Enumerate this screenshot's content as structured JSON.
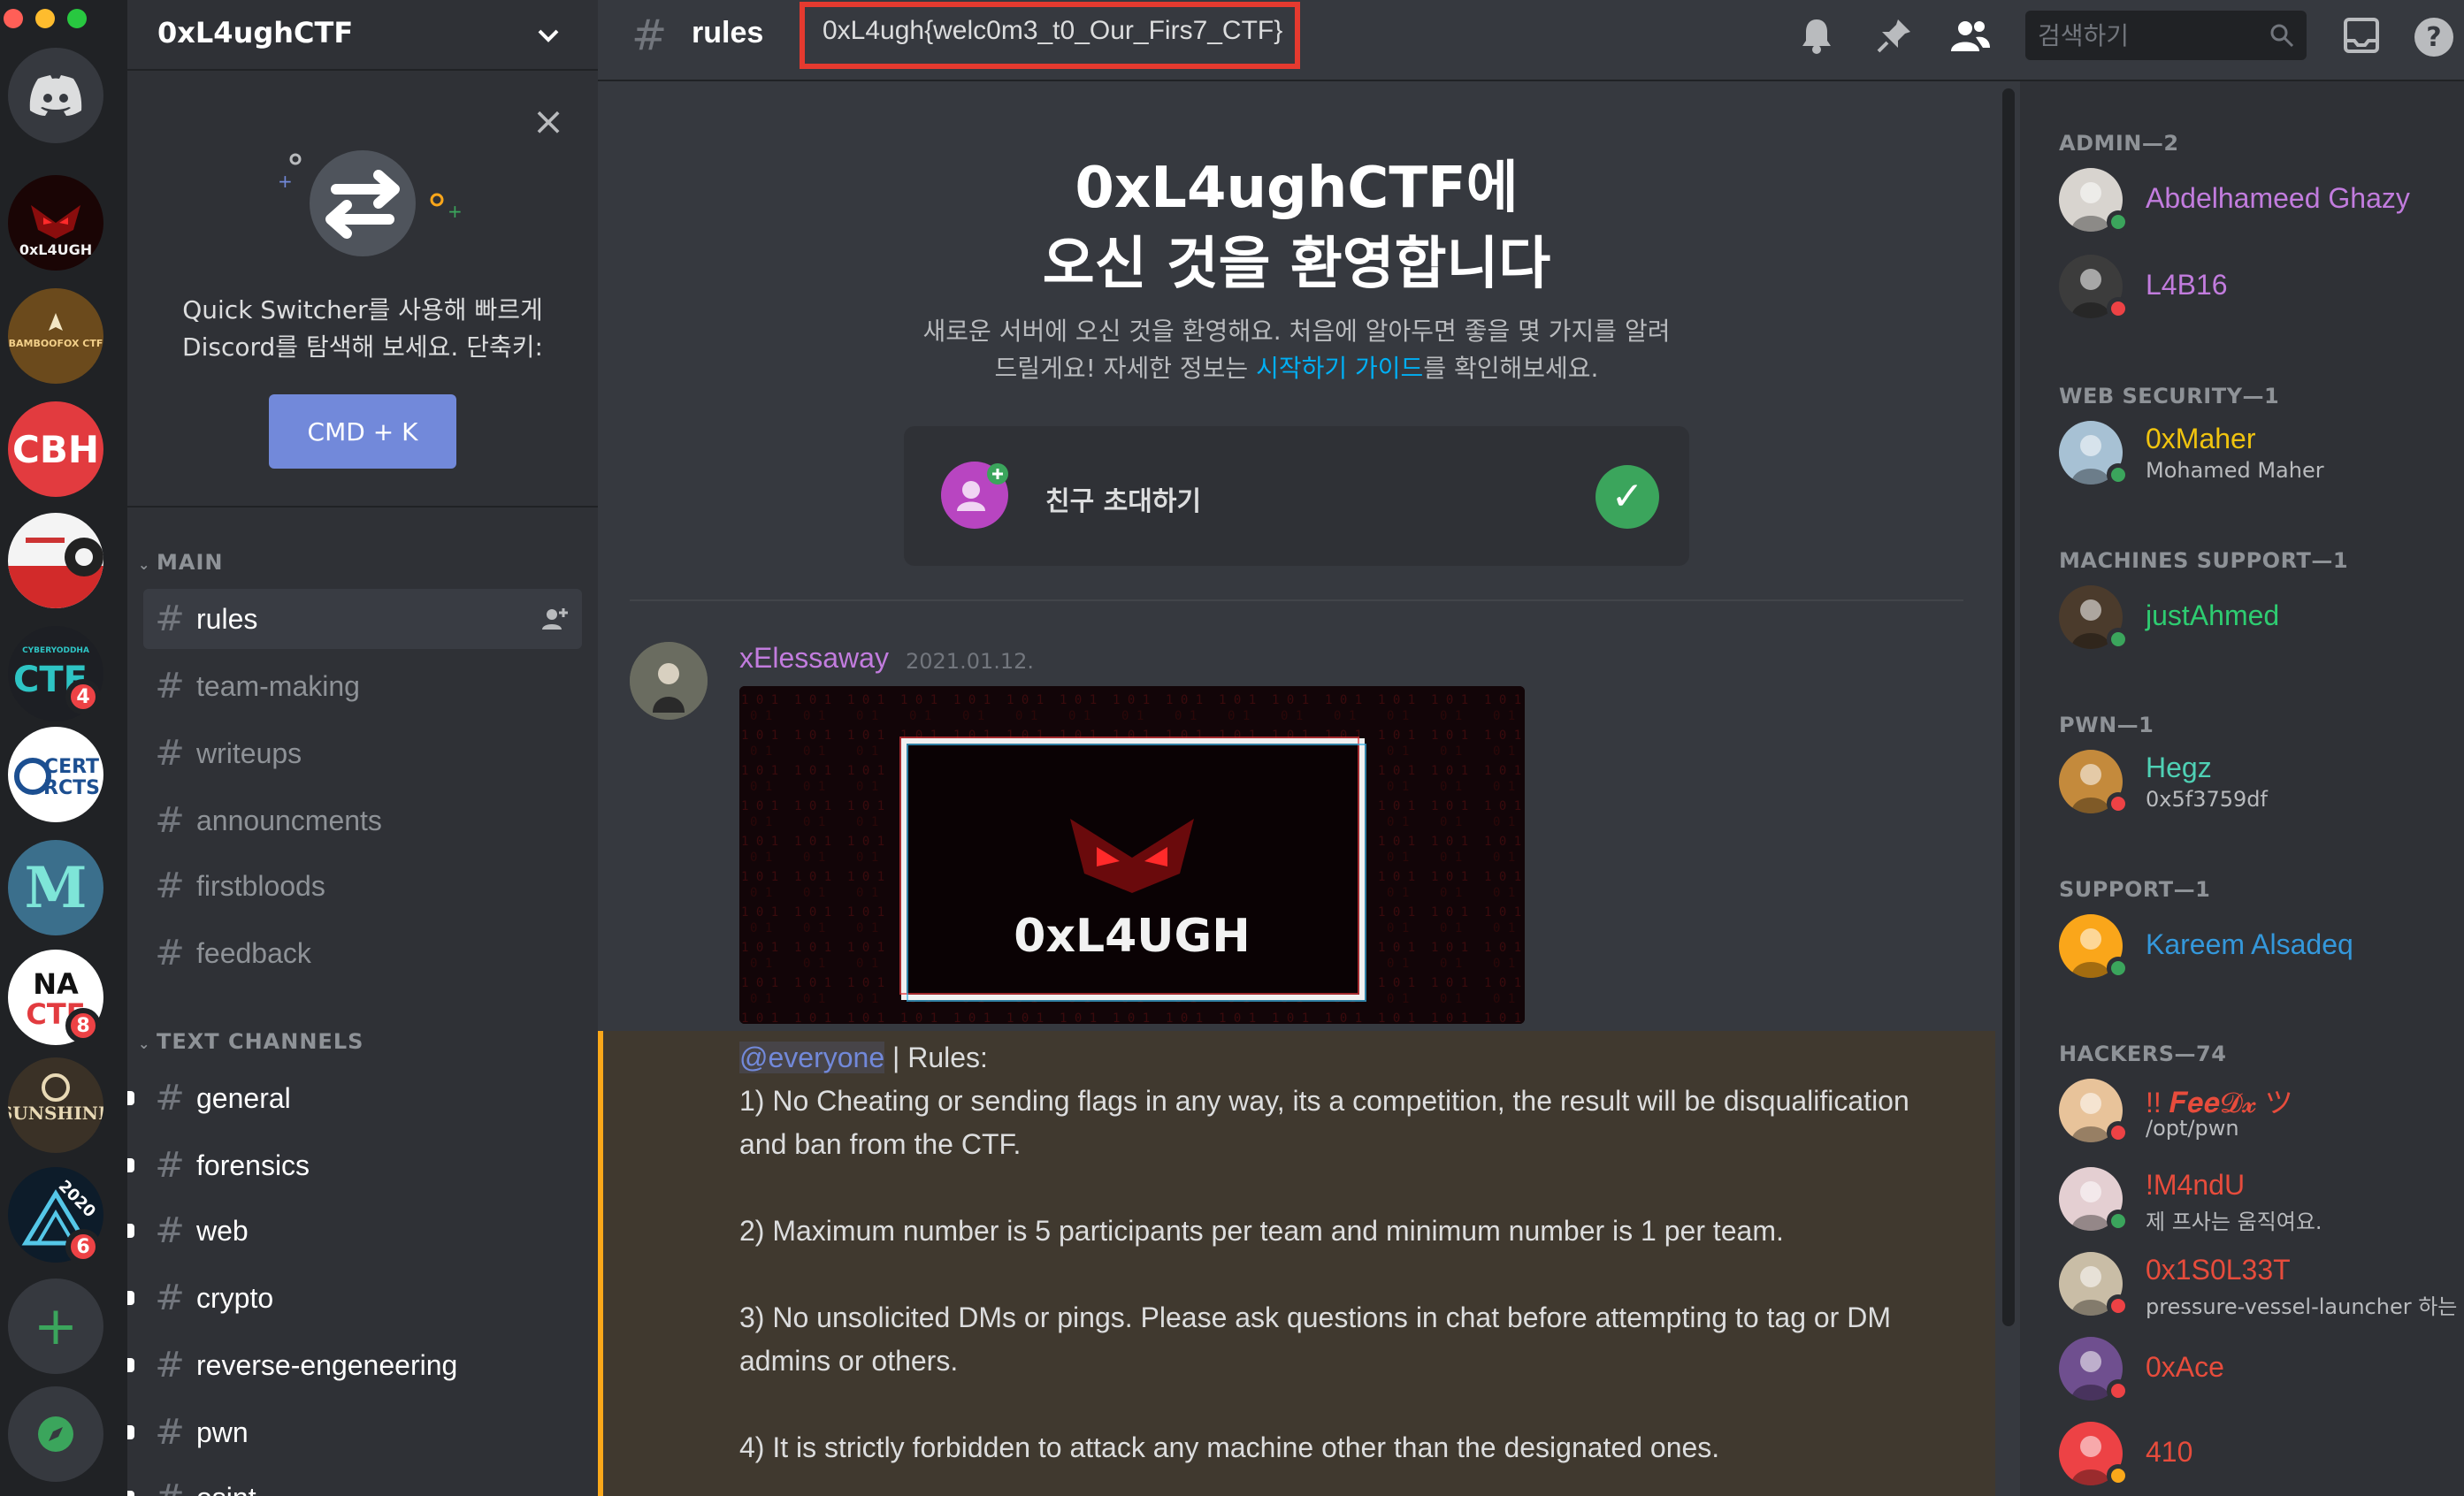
{
  "window": {
    "traffic_colors": [
      "#ff5f57",
      "#febc2e",
      "#28c840"
    ]
  },
  "servers": [
    {
      "name": "home",
      "label": ""
    },
    {
      "name": "0xl4ugh",
      "label": "0xL4UGH",
      "bg": "#1a0505",
      "fg": "#e03030"
    },
    {
      "name": "bamboofox",
      "label": "BAMBOOFOX CTF",
      "bg": "#6b4a1c",
      "fg": "#f3d08a"
    },
    {
      "name": "cbh",
      "label": "CBH",
      "bg": "#e23b3f",
      "fg": "#ffffff"
    },
    {
      "name": "meituan",
      "label": "",
      "bg": "#f4f4f4",
      "fg": "#d22"
    },
    {
      "name": "cyberyoddha",
      "label": "CTF",
      "bg": "#1d1f24",
      "fg": "#2ec4c4",
      "badge": "4"
    },
    {
      "name": "cert",
      "label": "CERT RCTS",
      "bg": "#ffffff",
      "fg": "#1c4f91"
    },
    {
      "name": "m",
      "label": "M",
      "bg": "#3b6f8c",
      "fg": "#7ee5d8"
    },
    {
      "name": "nactf",
      "label": "NA CTF",
      "bg": "#ffffff",
      "fg": "#111111",
      "badge": "8"
    },
    {
      "name": "sunshine",
      "label": "SUNSHINE",
      "bg": "#3a3126",
      "fg": "#e8d9b5"
    },
    {
      "name": "ctf-2020",
      "label": "2020",
      "bg": "#0d1c2a",
      "fg": "#55c7e8",
      "badge": "6"
    }
  ],
  "sidebar": {
    "server_name": "0xL4ughCTF",
    "quick_switcher_text": "Quick Switcher를 사용해 빠르게\nDiscord를 탐색해 보세요. 단축키:",
    "quick_switcher_button": "CMD + K",
    "categories": {
      "main": "MAIN",
      "text": "TEXT CHANNELS"
    },
    "main_channels": [
      "rules",
      "team-making",
      "writeups",
      "announcments",
      "firstbloods",
      "feedback"
    ],
    "text_channels": [
      "general",
      "forensics",
      "web",
      "crypto",
      "reverse-engeneering",
      "pwn",
      "osint"
    ]
  },
  "header": {
    "channel": "rules",
    "topic": "0xL4ugh{welc0m3_t0_Our_Firs7_CTF}",
    "search_placeholder": "검색하기"
  },
  "welcome": {
    "title_line1": "0xL4ughCTF에",
    "title_line2": "오신 것을 환영합니다",
    "sub_line1": "새로운 서버에 오신 것을 환영해요. 처음에 알아두면 좋을 몇 가지를 알려",
    "sub_line2_before": "드릴게요! 자세한 정보는 ",
    "sub_line2_link": "시작하기 가이드",
    "sub_line2_after": "를 확인해보세요.",
    "invite_label": "친구 초대하기"
  },
  "message": {
    "author": "xElessaway",
    "timestamp": "2021.01.12.",
    "image_text": "0xL4UGH",
    "mention": "@everyone",
    "first_line_rest": " | Rules:",
    "rules": [
      "1) No Cheating or sending flags in any way, its a competition, the result will be disqualification and ban from the CTF.",
      "2) Maximum number is 5 participants per team and minimum number is 1 per team.",
      "3) No unsolicited DMs or pings. Please ask questions in chat before attempting to tag or DM admins or others.",
      "4) It is strictly forbidden to attack any machine other than the designated ones."
    ]
  },
  "members": {
    "roles": [
      {
        "title": "ADMIN—2",
        "members": [
          {
            "name": "Abdelhameed Ghazy",
            "color": "#c27cde",
            "status": "online",
            "sub": "",
            "avatar_bg": "#d8d4cf"
          },
          {
            "name": "L4B16",
            "color": "#c27cde",
            "status": "dnd",
            "sub": "",
            "avatar_bg": "#3c3c3c"
          }
        ]
      },
      {
        "title": "WEB SECURITY—1",
        "members": [
          {
            "name": "0xMaher",
            "color": "#f1c40f",
            "status": "online",
            "sub": "Mohamed Maher",
            "avatar_bg": "#a7c1d4"
          }
        ]
      },
      {
        "title": "MACHINES SUPPORT—1",
        "members": [
          {
            "name": "justAhmed",
            "color": "#2ecc71",
            "status": "online",
            "sub": "",
            "avatar_bg": "#4b3b2c"
          }
        ]
      },
      {
        "title": "PWN—1",
        "members": [
          {
            "name": "Hegz",
            "color": "#4fd1b5",
            "status": "dnd",
            "sub": "0x5f3759df",
            "avatar_bg": "#c48a3c"
          }
        ]
      },
      {
        "title": "SUPPORT—1",
        "members": [
          {
            "name": "Kareem Alsadeq",
            "color": "#3498db",
            "status": "online",
            "sub": "",
            "avatar_bg": "#faa61a"
          }
        ]
      },
      {
        "title": "HACKERS—74",
        "members": [
          {
            "name": "!! 𝑭𝒆𝒆𝓓𝔁 ツ",
            "color": "#e74c3c",
            "status": "dnd",
            "sub": "/opt/pwn",
            "avatar_bg": "#e8c39a"
          },
          {
            "name": "!M4ndU",
            "color": "#e74c3c",
            "status": "online",
            "sub": "제 프사는 움직여요.",
            "avatar_bg": "#e4cfd2"
          },
          {
            "name": "0x1S0L33T",
            "color": "#e74c3c",
            "status": "dnd",
            "sub": "pressure-vessel-launcher 하는 ...",
            "avatar_bg": "#c9bda6"
          },
          {
            "name": "0xAce",
            "color": "#e74c3c",
            "status": "dnd",
            "sub": "",
            "avatar_bg": "#6f4f8f"
          },
          {
            "name": "410",
            "color": "#e74c3c",
            "status": "idle",
            "sub": "",
            "avatar_bg": "#ed4245"
          }
        ]
      }
    ]
  },
  "colors": {
    "online": "#3ba55c",
    "dnd": "#ed4245",
    "idle": "#faa81a",
    "accent": "#7289da",
    "highlight_box": "#e53a2f"
  }
}
